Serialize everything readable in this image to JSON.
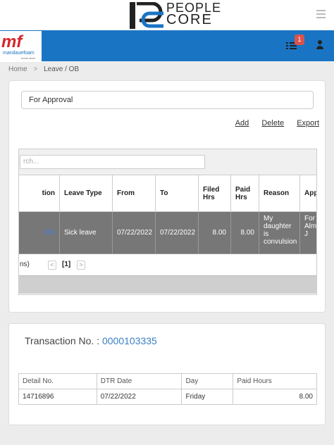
{
  "header": {
    "logo_line1": "PEOPLE",
    "logo_line2": "CORE",
    "brand_mark": "mf",
    "brand_name": "mandauefoam",
    "brand_sub": "home store",
    "notification_count": "1"
  },
  "breadcrumb": {
    "home": "Home",
    "separator": ">",
    "current": "Leave / OB"
  },
  "filter": {
    "selected": "For Approval"
  },
  "actions": {
    "add": "Add",
    "delete": "Delete",
    "export": "Export"
  },
  "grid": {
    "search_placeholder": "rch...",
    "columns": [
      "tion",
      "Leave Type",
      "From",
      "To",
      "Filed Hrs",
      "Paid Hrs",
      "Reason",
      "Approval"
    ],
    "rows": [
      {
        "transaction": "335",
        "leave_type": "Sick leave",
        "from": "07/22/2022",
        "to": "07/22/2022",
        "filed_hrs": "8.00",
        "paid_hrs": "8.00",
        "reason": "My daughter is convulsion",
        "approval": "For First A -> Almario Analissa J"
      }
    ],
    "pager": {
      "rows_text": "ns)",
      "prev": "<",
      "page": "[1]",
      "next": ">"
    }
  },
  "transaction": {
    "label": "Transaction No. :",
    "number": "0000103335",
    "detail_columns": [
      "Detail No.",
      "DTR Date",
      "Day",
      "Paid Hours"
    ],
    "detail_rows": [
      {
        "detail_no": "14716896",
        "dtr_date": "07/22/2022",
        "day": "Friday",
        "paid_hours": "8.00"
      }
    ]
  },
  "colors": {
    "primary": "#1a74c4",
    "brand_red": "#d6262b",
    "badge": "#d9534f",
    "link": "#3b7fc4",
    "selected_row": "#777777"
  }
}
